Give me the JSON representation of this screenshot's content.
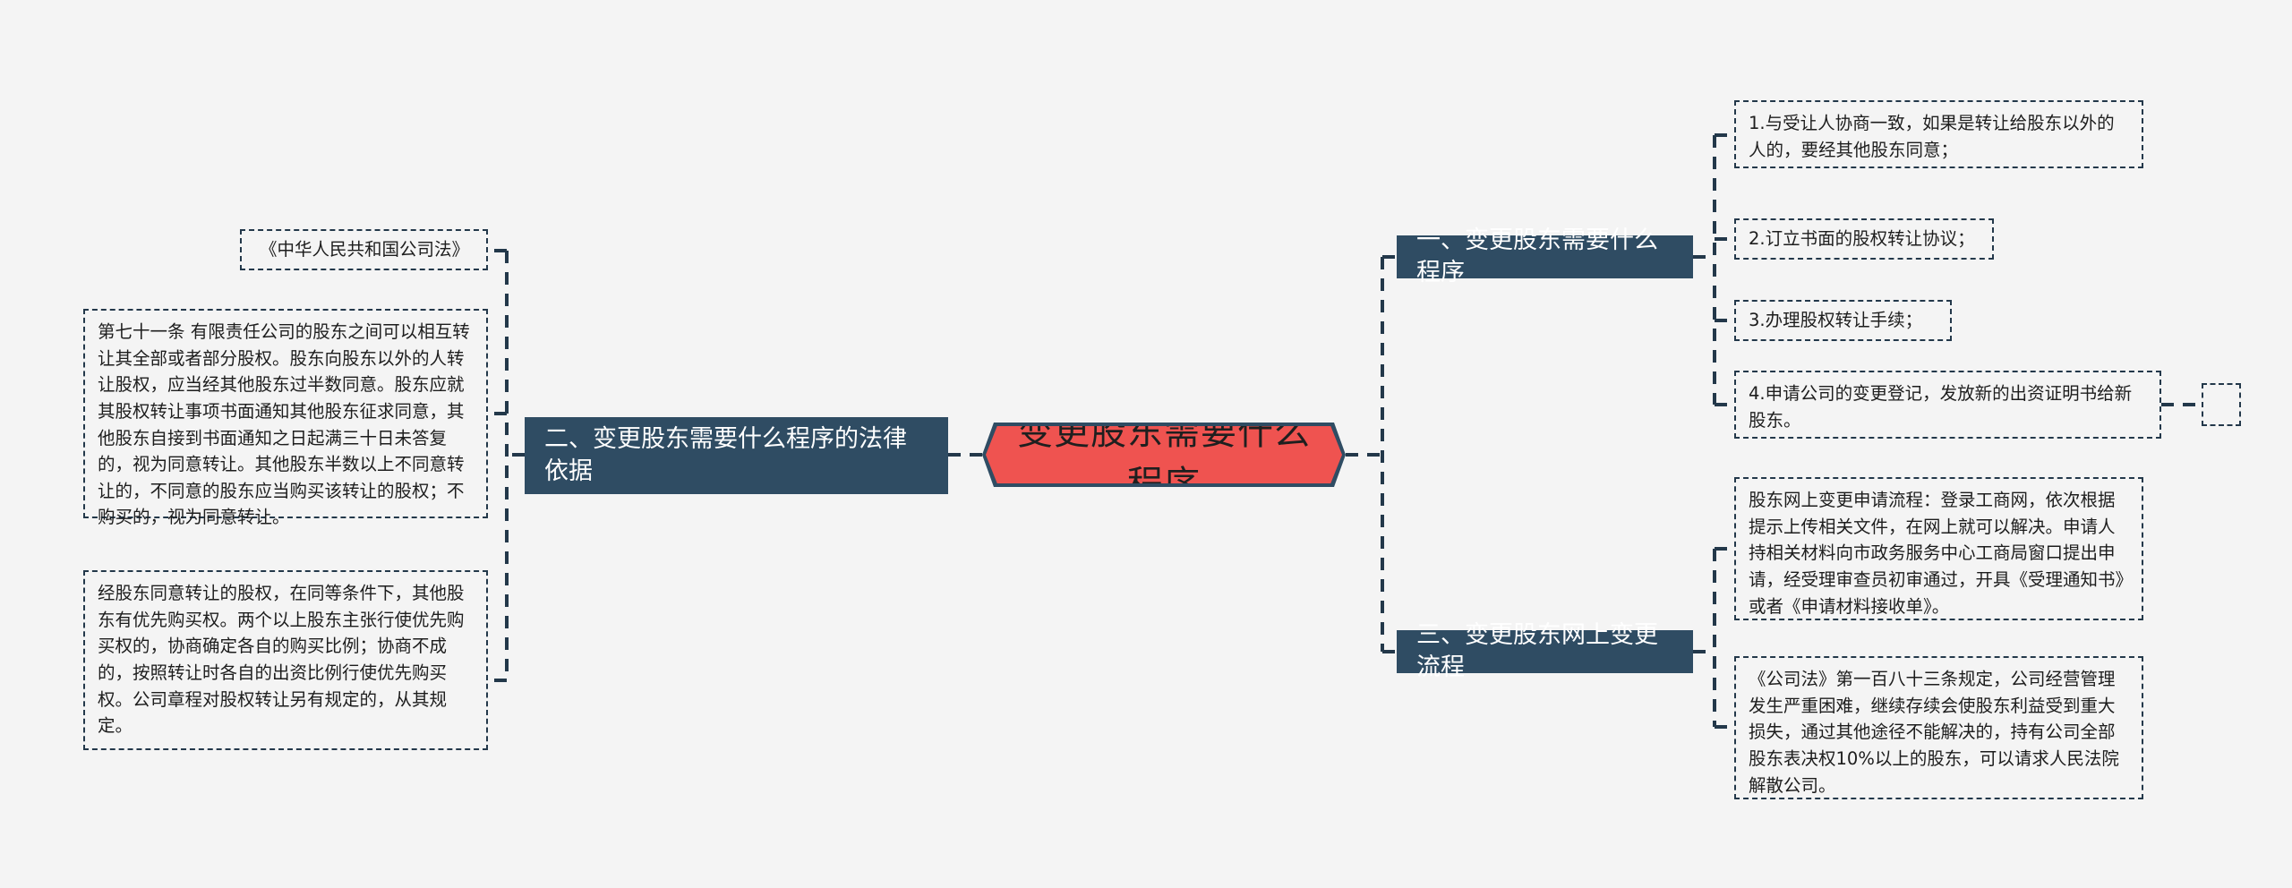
{
  "meta": {
    "background_color": "#f4f4f4",
    "accent_color": "#ef5350",
    "branch_color": "#2f4c63",
    "outline_color": "#23384a"
  },
  "central": {
    "label": "变更股东需要什么程序"
  },
  "branches": [
    {
      "id": "branch-1",
      "label": "一、变更股东需要什么程序",
      "side": "right",
      "children": [
        {
          "id": "leaf-r1",
          "text": "1.与受让人协商一致，如果是转让给股东以外的人的，要经其他股东同意；"
        },
        {
          "id": "leaf-r2",
          "text": "2.订立书面的股权转让协议；"
        },
        {
          "id": "leaf-r3",
          "text": "3.办理股权转让手续；"
        },
        {
          "id": "leaf-r4",
          "text": "4.申请公司的变更登记，发放新的出资证明书给新股东。"
        }
      ]
    },
    {
      "id": "branch-2",
      "label": "二、变更股东需要什么程序的法律依据",
      "side": "left",
      "children": [
        {
          "id": "leaf-l1",
          "text": "《中华人民共和国公司法》"
        },
        {
          "id": "leaf-l2",
          "text": "第七十一条 有限责任公司的股东之间可以相互转让其全部或者部分股权。股东向股东以外的人转让股权，应当经其他股东过半数同意。股东应就其股权转让事项书面通知其他股东征求同意，其他股东自接到书面通知之日起满三十日未答复的，视为同意转让。其他股东半数以上不同意转让的，不同意的股东应当购买该转让的股权；不购买的，视为同意转让。"
        },
        {
          "id": "leaf-l3",
          "text": "经股东同意转让的股权，在同等条件下，其他股东有优先购买权。两个以上股东主张行使优先购买权的，协商确定各自的购买比例；协商不成的，按照转让时各自的出资比例行使优先购买权。公司章程对股权转让另有规定的，从其规定。"
        }
      ]
    },
    {
      "id": "branch-3",
      "label": "三、变更股东网上变更流程",
      "side": "right",
      "children": [
        {
          "id": "leaf-r5",
          "text": "股东网上变更申请流程：登录工商网，依次根据提示上传相关文件，在网上就可以解决。申请人持相关材料向市政务服务中心工商局窗口提出申请，经受理审查员初审通过，开具《受理通知书》或者《申请材料接收单》。"
        },
        {
          "id": "leaf-r6",
          "text": "《公司法》第一百八十三条规定，公司经营管理发生严重困难，继续存续会使股东利益受到重大损失，通过其他途径不能解决的，持有公司全部股东表决权10%以上的股东，可以请求人民法院解散公司。"
        }
      ]
    }
  ],
  "stub_node": {
    "id": "leaf-stub",
    "text": ""
  }
}
